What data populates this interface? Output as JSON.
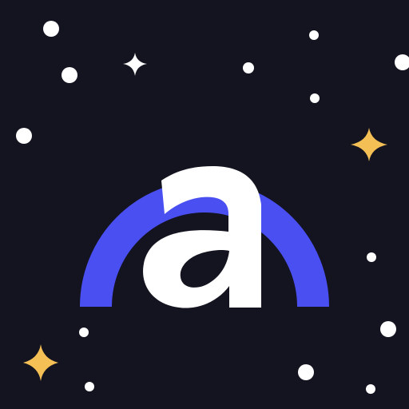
{
  "icon": {
    "name": "app-icon",
    "letter": "a",
    "logo": "arc-logo",
    "colors": {
      "background": "#141420",
      "arc": "#4a4ff2",
      "letter": "#ffffff",
      "star_white": "#ffffff",
      "star_gold": "#f4bf54"
    },
    "decorations": [
      "white-dot-stars",
      "white-sparkle-star",
      "gold-sparkle-stars"
    ]
  }
}
